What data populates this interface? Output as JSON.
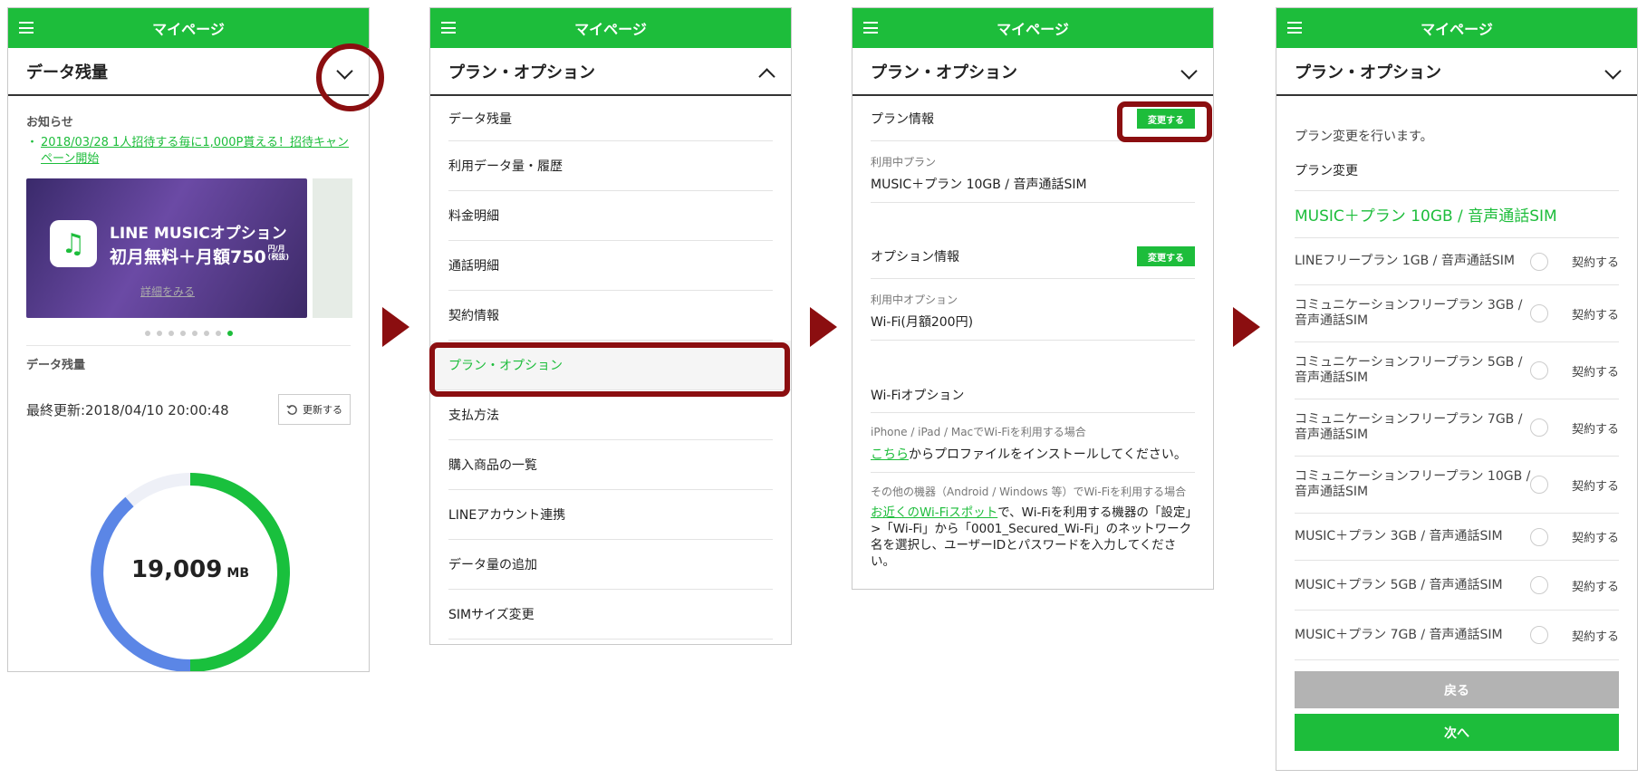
{
  "app_title": "マイページ",
  "accent_color": "#1dbd3b",
  "highlight_color": "#8b0e10",
  "panel1": {
    "section_title": "データ残量",
    "news_label": "お知らせ",
    "news_item": "2018/03/28 1人招待する毎に1,000P貰える！招待キャンペーン開始",
    "banner": {
      "line1": "LINE MUSICオプション",
      "line2": "初月無料＋月額750",
      "price_unit": "円/月(税抜)",
      "link": "詳細をみる"
    },
    "carousel_pages": 8,
    "carousel_active": 8,
    "data_label": "データ残量",
    "last_updated": "最終更新:2018/04/10 20:00:48",
    "refresh_button": "更新する",
    "remaining_value": "19,009",
    "remaining_unit": "MB"
  },
  "panel2": {
    "section_title": "プラン・オプション",
    "menu_items": [
      "データ残量",
      "利用データ量・履歴",
      "料金明細",
      "通話明細",
      "契約情報",
      "プラン・オプション",
      "支払方法",
      "購入商品の一覧",
      "LINEアカウント連携",
      "データ量の追加",
      "SIMサイズ変更"
    ]
  },
  "panel3": {
    "section_title": "プラン・オプション",
    "plan_info_label": "プラン情報",
    "change_button": "変更する",
    "current_plan_label": "利用中プラン",
    "current_plan": "MUSIC＋プラン 10GB / 音声通話SIM",
    "option_info_label": "オプション情報",
    "current_option_label": "利用中オプション",
    "current_option": "Wi-Fi(月額200円)",
    "wifi_option_label": "Wi-Fiオプション",
    "iphone_label": "iPhone / iPad / MacでWi-Fiを利用する場合",
    "iphone_link": "こちら",
    "iphone_text": "からプロファイルをインストールしてください。",
    "other_label": "その他の機器（Android / Windows 等）でWi-Fiを利用する場合",
    "other_link": "お近くのWi-Fiスポット",
    "other_text": "で、Wi-Fiを利用する機器の「設定」>「Wi-Fi」から「0001_Secured_Wi-Fi」のネットワーク名を選択し、ユーザーIDとパスワードを入力してください。"
  },
  "panel4": {
    "section_title": "プラン・オプション",
    "intro": "プラン変更を行います。",
    "change_label": "プラン変更",
    "current_plan": "MUSIC＋プラン 10GB / 音声通話SIM",
    "contract_label": "契約する",
    "plans": [
      "LINEフリープラン 1GB / 音声通話SIM",
      "コミュニケーションフリープラン 3GB / 音声通話SIM",
      "コミュニケーションフリープラン 5GB / 音声通話SIM",
      "コミュニケーションフリープラン 7GB / 音声通話SIM",
      "コミュニケーションフリープラン 10GB / 音声通話SIM",
      "MUSIC＋プラン 3GB / 音声通話SIM",
      "MUSIC＋プラン 5GB / 音声通話SIM",
      "MUSIC＋プラン 7GB / 音声通話SIM"
    ],
    "back_button": "戻る",
    "next_button": "次へ"
  }
}
